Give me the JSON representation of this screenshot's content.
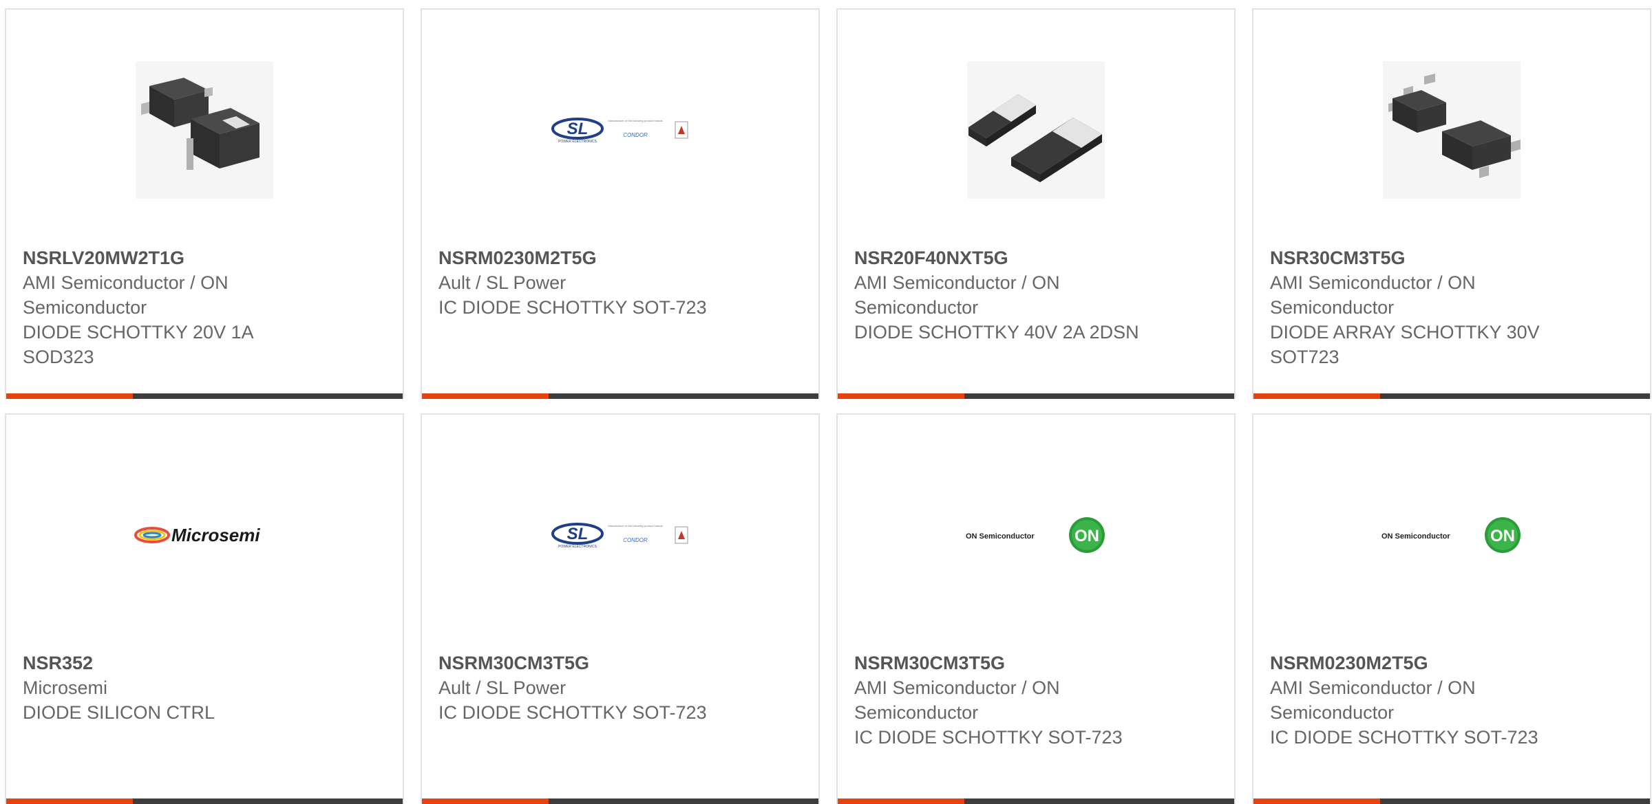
{
  "colors": {
    "accent": "#e5420f",
    "bar": "#3d3d3d",
    "border": "#e2e2e2",
    "text": "#666666"
  },
  "products": [
    {
      "part": "NSRLV20MW2T1G",
      "manufacturer": "AMI Semiconductor / ON Semiconductor",
      "description": "DIODE SCHOTTKY 20V 1A SOD323",
      "image": "sod323-package-photo"
    },
    {
      "part": "NSRM0230M2T5G",
      "manufacturer": "Ault / SL Power",
      "description": "IC DIODE SCHOTTKY SOT-723",
      "image": "sl-power-logo",
      "logo": {
        "mark": "SL",
        "caption": "POWER ELECTRONICS",
        "brand": "CONDOR",
        "note": "Manufacturer of the following product brands"
      }
    },
    {
      "part": "NSR20F40NXT5G",
      "manufacturer": "AMI Semiconductor / ON Semiconductor",
      "description": "DIODE SCHOTTKY 40V 2A 2DSN",
      "image": "2dsn-package-photo"
    },
    {
      "part": "NSR30CM3T5G",
      "manufacturer": "AMI Semiconductor / ON Semiconductor",
      "description": "DIODE ARRAY SCHOTTKY 30V SOT723",
      "image": "sot723-package-photo"
    },
    {
      "part": "NSR352",
      "manufacturer": "Microsemi",
      "description": "DIODE SILICON CTRL",
      "image": "microsemi-logo",
      "logo": {
        "text": "Microsemi"
      }
    },
    {
      "part": "NSRM30CM3T5G",
      "manufacturer": "Ault / SL Power",
      "description": "IC DIODE SCHOTTKY SOT-723",
      "image": "sl-power-logo",
      "logo": {
        "mark": "SL",
        "caption": "POWER ELECTRONICS",
        "brand": "CONDOR",
        "note": "Manufacturer of the following product brands"
      }
    },
    {
      "part": "NSRM30CM3T5G",
      "manufacturer": "AMI Semiconductor / ON Semiconductor",
      "description": "IC DIODE SCHOTTKY SOT-723",
      "image": "on-semiconductor-logo",
      "logo": {
        "text": "ON Semiconductor",
        "badge": "ON"
      }
    },
    {
      "part": "NSRM0230M2T5G",
      "manufacturer": "AMI Semiconductor / ON Semiconductor",
      "description": "IC DIODE SCHOTTKY SOT-723",
      "image": "on-semiconductor-logo",
      "logo": {
        "text": "ON Semiconductor",
        "badge": "ON"
      }
    }
  ]
}
